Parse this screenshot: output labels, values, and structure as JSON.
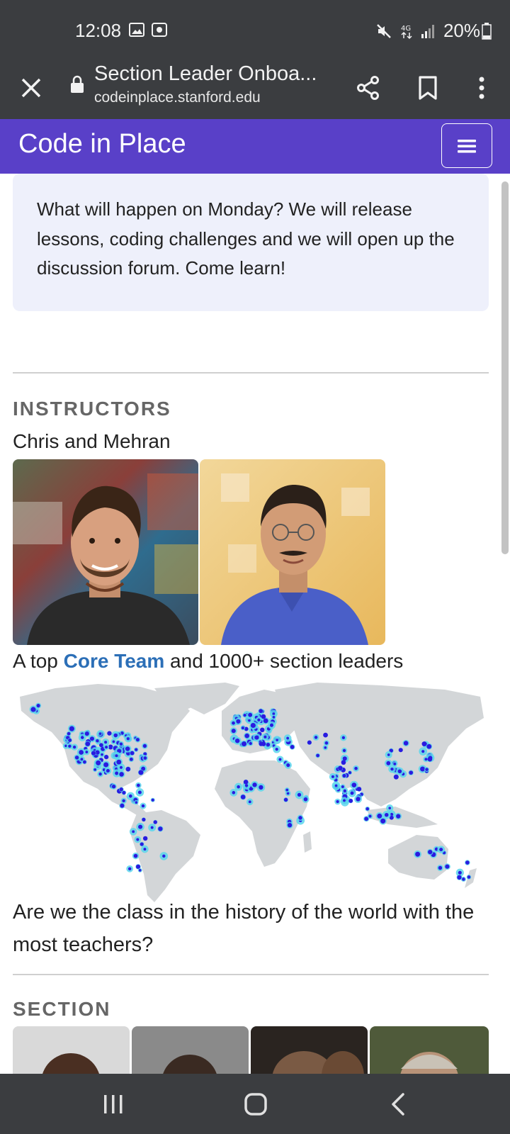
{
  "status_bar": {
    "time": "12:08",
    "battery": "20%",
    "icons": [
      "image-icon",
      "screen-record-icon",
      "mute-icon",
      "4g-icon",
      "signal-icon",
      "battery-icon"
    ]
  },
  "browser": {
    "page_title": "Section Leader Onboa...",
    "url": "codeinplace.stanford.edu",
    "icons": [
      "close-icon",
      "lock-icon",
      "share-icon",
      "bookmark-icon",
      "more-icon"
    ]
  },
  "site_header": {
    "brand": "Code in Place",
    "menu_icon": "hamburger-icon",
    "color": "#5940c8"
  },
  "callout": {
    "text": "What will happen on Monday? We will release lessons, coding challenges and we will open up the discussion forum. Come learn!"
  },
  "instructors": {
    "label": "INSTRUCTORS",
    "names": "Chris and Mehran"
  },
  "team_line": {
    "prefix": "A top ",
    "link": "Core Team",
    "suffix": " and 1000+ section leaders"
  },
  "question": "Are we the class in the history of the world with the most teachers?",
  "section": {
    "label": "SECTION"
  },
  "colors": {
    "link": "#2c6fb7",
    "map_land": "#d3d6d8",
    "map_dot_dark": "#2a1be0",
    "map_dot_light": "#5ad6ec"
  },
  "nav_bar": {
    "icons": [
      "recent-apps-icon",
      "home-icon",
      "back-icon"
    ]
  }
}
